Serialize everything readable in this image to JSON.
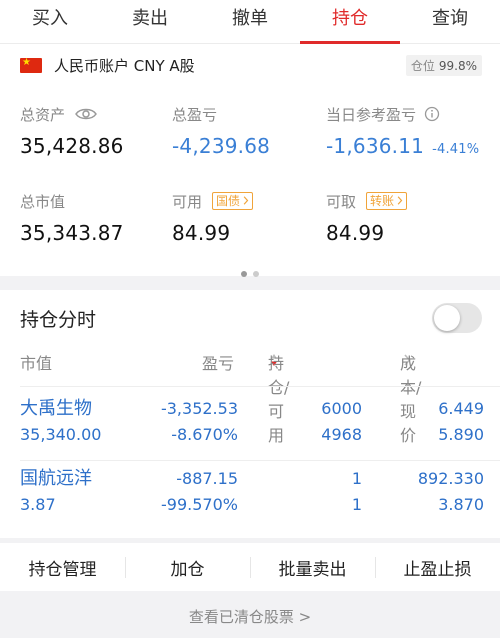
{
  "tabs": [
    {
      "label": "买入"
    },
    {
      "label": "卖出"
    },
    {
      "label": "撤单"
    },
    {
      "label": "持仓"
    },
    {
      "label": "查询"
    }
  ],
  "account": {
    "title": "人民币账户 CNY A股",
    "position_label": "仓位",
    "position_value": "99.8%",
    "total_assets_label": "总资产",
    "total_assets": "35,428.86",
    "total_pl_label": "总盈亏",
    "total_pl": "-4,239.68",
    "daily_pl_label": "当日参考盈亏",
    "daily_pl": "-1,636.11",
    "daily_pl_pct": "-4.41%",
    "market_value_label": "总市值",
    "market_value": "35,343.87",
    "available_label": "可用",
    "available": "84.99",
    "bond_button": "国债",
    "withdrawable_label": "可取",
    "withdrawable": "84.99",
    "transfer_button": "转账"
  },
  "holdings": {
    "title": "持仓分时",
    "columns": {
      "market_value": "市值",
      "pl": "盈亏",
      "position": "持仓/可用",
      "cost": "成本/现价"
    },
    "rows": [
      {
        "name": "大禹生物",
        "market_value": "35,340.00",
        "pl": "-3,352.53",
        "pl_pct": "-8.670%",
        "position": "6000",
        "available": "4968",
        "cost": "6.449",
        "price": "5.890"
      },
      {
        "name": "国航远洋",
        "market_value": "3.87",
        "pl": "-887.15",
        "pl_pct": "-99.570%",
        "position": "1",
        "available": "1",
        "cost": "892.330",
        "price": "3.870"
      }
    ]
  },
  "actions": [
    {
      "label": "持仓管理"
    },
    {
      "label": "加仓"
    },
    {
      "label": "批量卖出"
    },
    {
      "label": "止盈止损"
    }
  ],
  "cleared_link": "查看已清仓股票 >"
}
